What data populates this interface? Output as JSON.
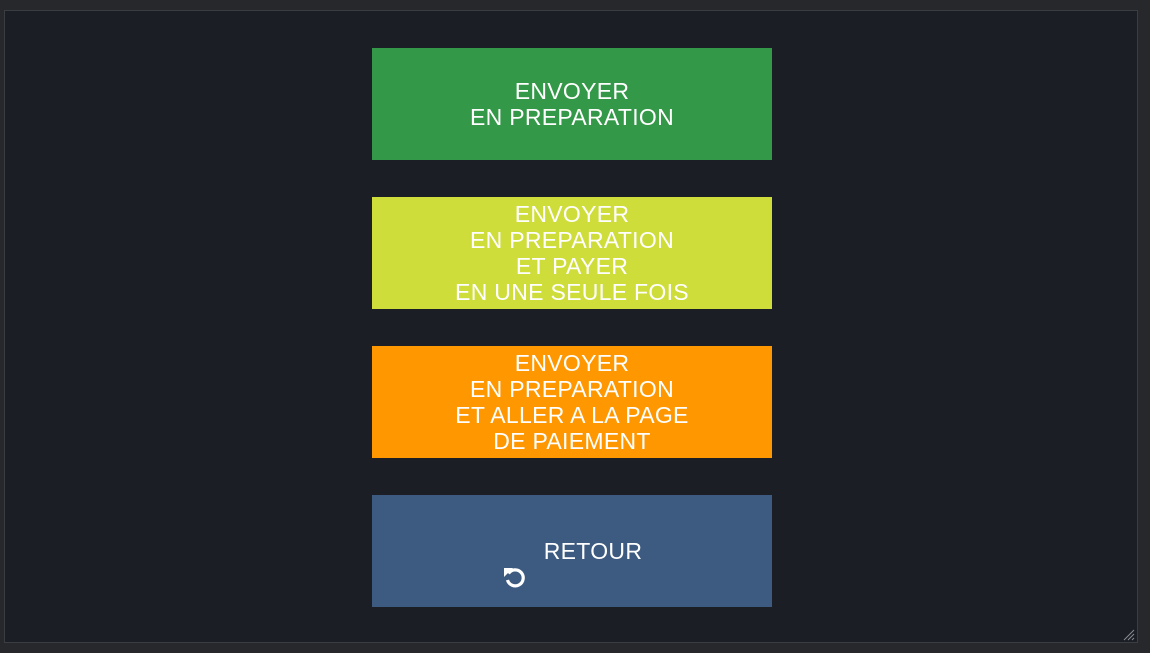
{
  "actions": {
    "send_prep": "ENVOYER\nEN PREPARATION",
    "send_prep_pay_once": "ENVOYER\nEN PREPARATION\nET PAYER\nEN UNE SEULE FOIS",
    "send_prep_payment_page": "ENVOYER\nEN PREPARATION\nET ALLER A LA PAGE\nDE PAIEMENT",
    "back_label": "RETOUR",
    "back_icon": "undo-icon"
  },
  "colors": {
    "green": "#339847",
    "lime": "#cfdd3a",
    "orange": "#ff9800",
    "blue": "#3d5a80",
    "panel": "#1b1e24"
  }
}
